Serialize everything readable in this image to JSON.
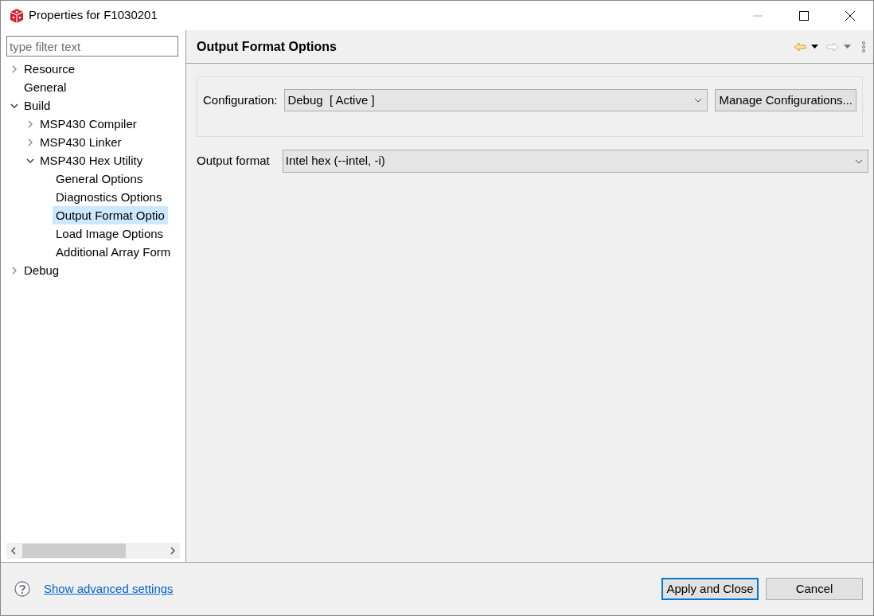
{
  "window": {
    "title": "Properties for F1030201"
  },
  "filter": {
    "placeholder": "type filter text"
  },
  "tree": [
    {
      "label": "Resource",
      "expanded": false,
      "selected": false
    },
    {
      "label": "General",
      "selected": false
    },
    {
      "label": "Build",
      "expanded": true,
      "selected": false,
      "children": [
        {
          "label": "MSP430 Compiler",
          "expanded": false,
          "selected": false
        },
        {
          "label": "MSP430 Linker",
          "expanded": false,
          "selected": false
        },
        {
          "label": "MSP430 Hex Utility",
          "expanded": true,
          "selected": false,
          "children": [
            {
              "label": "General Options",
              "selected": false
            },
            {
              "label": "Diagnostics Options",
              "selected": false
            },
            {
              "label": "Output Format Optio",
              "selected": true
            },
            {
              "label": "Load Image Options",
              "selected": false
            },
            {
              "label": "Additional Array Form",
              "selected": false
            }
          ]
        }
      ]
    },
    {
      "label": "Debug",
      "expanded": false,
      "selected": false
    }
  ],
  "page": {
    "title": "Output Format Options",
    "configuration": {
      "label": "Configuration:",
      "value": "Debug  [ Active ]",
      "button": "Manage Configurations..."
    },
    "output_format": {
      "label": "Output format",
      "value": "Intel hex (--intel, -i)"
    }
  },
  "footer": {
    "link": "Show advanced settings",
    "buttons": [
      {
        "label": "Apply and Close",
        "default": true
      },
      {
        "label": "Cancel",
        "default": false
      }
    ]
  }
}
